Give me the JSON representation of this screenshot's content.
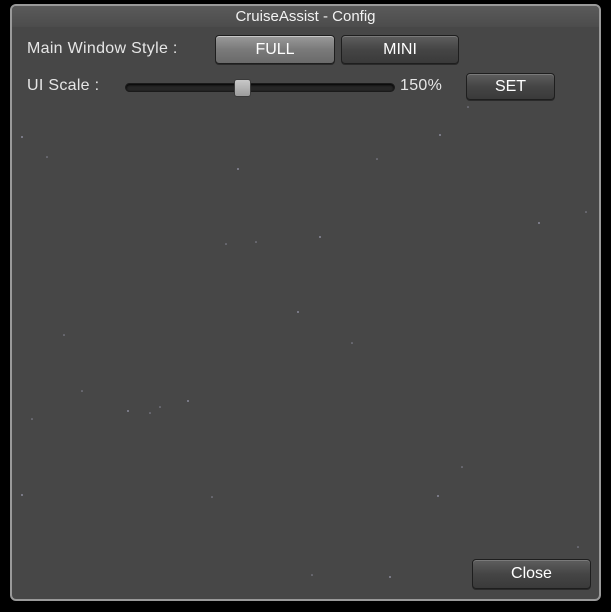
{
  "window": {
    "title": "CruiseAssist - Config"
  },
  "main_window_style": {
    "label": "Main Window Style :",
    "options": [
      "FULL",
      "MINI"
    ],
    "selected": "FULL"
  },
  "ui_scale": {
    "label": "UI Scale :",
    "value_text": "150%",
    "slider_fraction": 0.44,
    "set_label": "SET"
  },
  "footer": {
    "close_label": "Close"
  },
  "colors": {
    "window_bg": "#474747",
    "border": "#9a9a9a",
    "text": "#e6e6e6"
  }
}
